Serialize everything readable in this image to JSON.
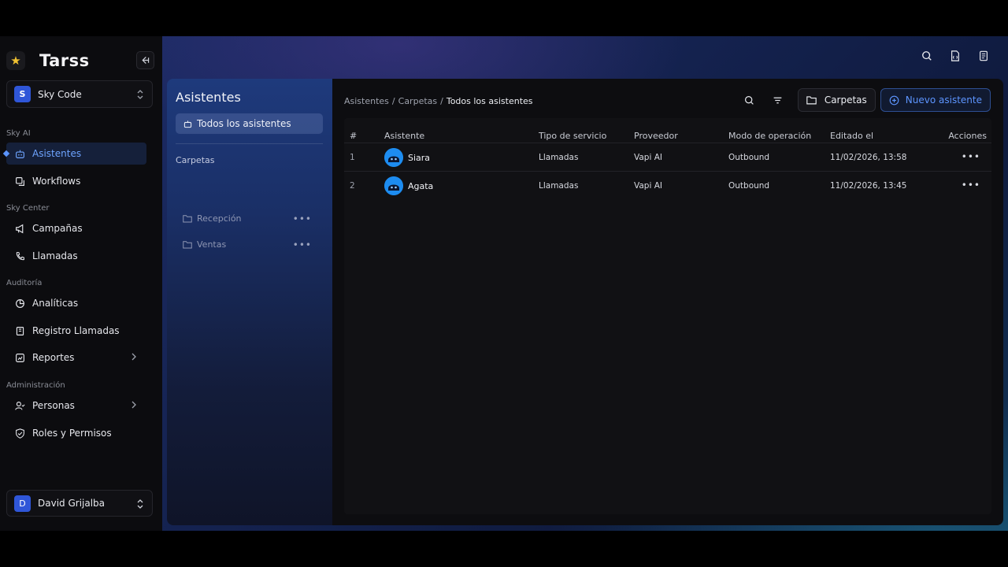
{
  "brand": {
    "name": "Tarss"
  },
  "workspace": {
    "initial": "S",
    "name": "Sky Code"
  },
  "sections": {
    "sky_ai": "Sky AI",
    "sky_center": "Sky Center",
    "auditoria": "Auditoría",
    "administracion": "Administración"
  },
  "nav": {
    "asistentes": "Asistentes",
    "workflows": "Workflows",
    "campanas": "Campañas",
    "llamadas": "Llamadas",
    "analiticas": "Analíticas",
    "registro": "Registro Llamadas",
    "reportes": "Reportes",
    "personas": "Personas",
    "roles": "Roles y Permisos"
  },
  "user": {
    "initial": "D",
    "name": "David Grijalba"
  },
  "folders_panel": {
    "title": "Asistentes",
    "all_label": "Todos los asistentes",
    "section": "Carpetas",
    "items": [
      "Recepción",
      "Ventas"
    ]
  },
  "breadcrumb": {
    "root": "Asistentes",
    "sep1": "/",
    "mid": "Carpetas",
    "sep2": "/",
    "current": "Todos los asistentes"
  },
  "toolbar": {
    "folders_label": "Carpetas",
    "new_label": "Nuevo asistente"
  },
  "table": {
    "headers": {
      "num": "#",
      "asistente": "Asistente",
      "tipo": "Tipo de servicio",
      "proveedor": "Proveedor",
      "modo": "Modo de operación",
      "editado": "Editado el",
      "acciones": "Acciones"
    },
    "rows": [
      {
        "num": "1",
        "name": "Siara",
        "tipo": "Llamadas",
        "proveedor": "Vapi AI",
        "modo": "Outbound",
        "editado": "11/02/2026, 13:58"
      },
      {
        "num": "2",
        "name": "Agata",
        "tipo": "Llamadas",
        "proveedor": "Vapi AI",
        "modo": "Outbound",
        "editado": "11/02/2026, 13:45"
      }
    ]
  },
  "colors": {
    "accent": "#5b95ff",
    "avatar_blue": "#2f56d8",
    "bot_blue": "#1d8cf0"
  }
}
